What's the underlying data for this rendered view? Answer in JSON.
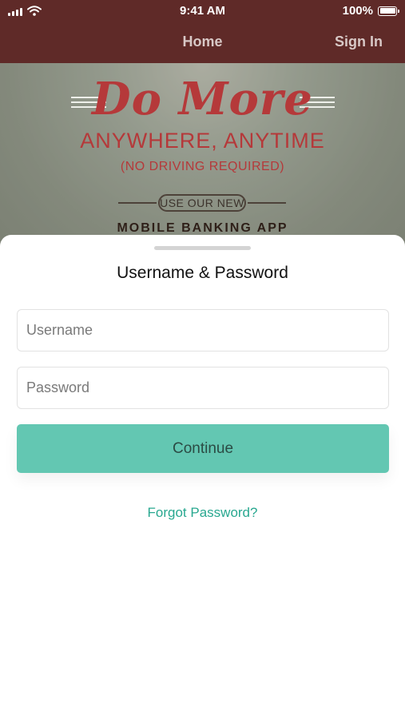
{
  "status_bar": {
    "time": "9:41 AM",
    "battery_percent": "100%",
    "signal_icon": "cellular-signal-icon",
    "wifi_icon": "wifi-icon",
    "battery_icon": "battery-icon"
  },
  "nav": {
    "title": "Home",
    "sign_in_label": "Sign In"
  },
  "banner": {
    "headline": "Do More",
    "subheadline": "ANYWHERE, ANYTIME",
    "tagline": "(NO DRIVING REQUIRED)",
    "badge_text": "USE OUR NEW",
    "app_text": "MOBILE BANKING APP"
  },
  "sheet": {
    "title": "Username & Password",
    "username_placeholder": "Username",
    "password_placeholder": "Password",
    "continue_label": "Continue",
    "forgot_label": "Forgot Password?"
  },
  "colors": {
    "header_bg": "#5f2a28",
    "accent_green": "#63c7b2",
    "link_green": "#29a890",
    "banner_red": "#b5393a"
  }
}
